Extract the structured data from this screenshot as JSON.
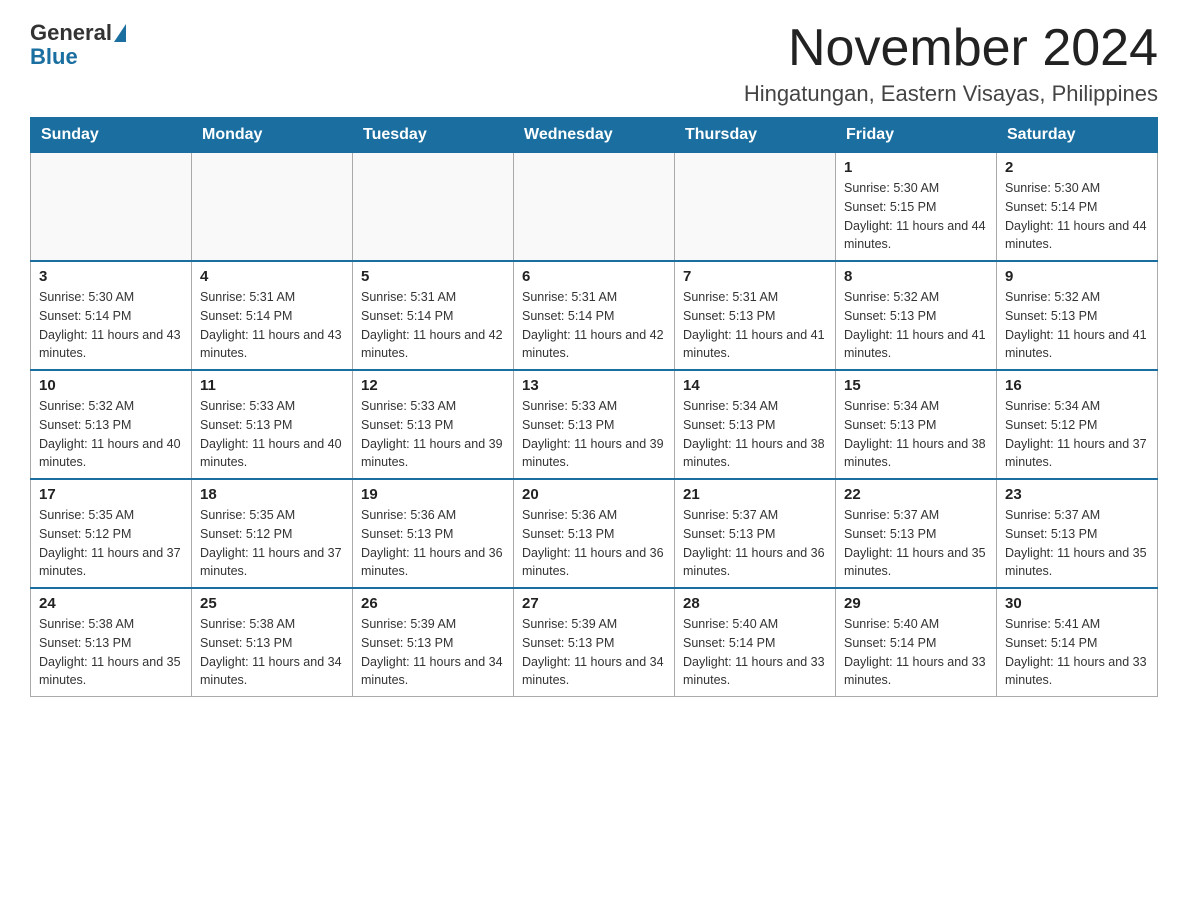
{
  "logo": {
    "text_general": "General",
    "text_blue": "Blue"
  },
  "header": {
    "month_title": "November 2024",
    "location": "Hingatungan, Eastern Visayas, Philippines"
  },
  "days_of_week": [
    "Sunday",
    "Monday",
    "Tuesday",
    "Wednesday",
    "Thursday",
    "Friday",
    "Saturday"
  ],
  "weeks": [
    [
      {
        "day": "",
        "sunrise": "",
        "sunset": "",
        "daylight": ""
      },
      {
        "day": "",
        "sunrise": "",
        "sunset": "",
        "daylight": ""
      },
      {
        "day": "",
        "sunrise": "",
        "sunset": "",
        "daylight": ""
      },
      {
        "day": "",
        "sunrise": "",
        "sunset": "",
        "daylight": ""
      },
      {
        "day": "",
        "sunrise": "",
        "sunset": "",
        "daylight": ""
      },
      {
        "day": "1",
        "sunrise": "Sunrise: 5:30 AM",
        "sunset": "Sunset: 5:15 PM",
        "daylight": "Daylight: 11 hours and 44 minutes."
      },
      {
        "day": "2",
        "sunrise": "Sunrise: 5:30 AM",
        "sunset": "Sunset: 5:14 PM",
        "daylight": "Daylight: 11 hours and 44 minutes."
      }
    ],
    [
      {
        "day": "3",
        "sunrise": "Sunrise: 5:30 AM",
        "sunset": "Sunset: 5:14 PM",
        "daylight": "Daylight: 11 hours and 43 minutes."
      },
      {
        "day": "4",
        "sunrise": "Sunrise: 5:31 AM",
        "sunset": "Sunset: 5:14 PM",
        "daylight": "Daylight: 11 hours and 43 minutes."
      },
      {
        "day": "5",
        "sunrise": "Sunrise: 5:31 AM",
        "sunset": "Sunset: 5:14 PM",
        "daylight": "Daylight: 11 hours and 42 minutes."
      },
      {
        "day": "6",
        "sunrise": "Sunrise: 5:31 AM",
        "sunset": "Sunset: 5:14 PM",
        "daylight": "Daylight: 11 hours and 42 minutes."
      },
      {
        "day": "7",
        "sunrise": "Sunrise: 5:31 AM",
        "sunset": "Sunset: 5:13 PM",
        "daylight": "Daylight: 11 hours and 41 minutes."
      },
      {
        "day": "8",
        "sunrise": "Sunrise: 5:32 AM",
        "sunset": "Sunset: 5:13 PM",
        "daylight": "Daylight: 11 hours and 41 minutes."
      },
      {
        "day": "9",
        "sunrise": "Sunrise: 5:32 AM",
        "sunset": "Sunset: 5:13 PM",
        "daylight": "Daylight: 11 hours and 41 minutes."
      }
    ],
    [
      {
        "day": "10",
        "sunrise": "Sunrise: 5:32 AM",
        "sunset": "Sunset: 5:13 PM",
        "daylight": "Daylight: 11 hours and 40 minutes."
      },
      {
        "day": "11",
        "sunrise": "Sunrise: 5:33 AM",
        "sunset": "Sunset: 5:13 PM",
        "daylight": "Daylight: 11 hours and 40 minutes."
      },
      {
        "day": "12",
        "sunrise": "Sunrise: 5:33 AM",
        "sunset": "Sunset: 5:13 PM",
        "daylight": "Daylight: 11 hours and 39 minutes."
      },
      {
        "day": "13",
        "sunrise": "Sunrise: 5:33 AM",
        "sunset": "Sunset: 5:13 PM",
        "daylight": "Daylight: 11 hours and 39 minutes."
      },
      {
        "day": "14",
        "sunrise": "Sunrise: 5:34 AM",
        "sunset": "Sunset: 5:13 PM",
        "daylight": "Daylight: 11 hours and 38 minutes."
      },
      {
        "day": "15",
        "sunrise": "Sunrise: 5:34 AM",
        "sunset": "Sunset: 5:13 PM",
        "daylight": "Daylight: 11 hours and 38 minutes."
      },
      {
        "day": "16",
        "sunrise": "Sunrise: 5:34 AM",
        "sunset": "Sunset: 5:12 PM",
        "daylight": "Daylight: 11 hours and 37 minutes."
      }
    ],
    [
      {
        "day": "17",
        "sunrise": "Sunrise: 5:35 AM",
        "sunset": "Sunset: 5:12 PM",
        "daylight": "Daylight: 11 hours and 37 minutes."
      },
      {
        "day": "18",
        "sunrise": "Sunrise: 5:35 AM",
        "sunset": "Sunset: 5:12 PM",
        "daylight": "Daylight: 11 hours and 37 minutes."
      },
      {
        "day": "19",
        "sunrise": "Sunrise: 5:36 AM",
        "sunset": "Sunset: 5:13 PM",
        "daylight": "Daylight: 11 hours and 36 minutes."
      },
      {
        "day": "20",
        "sunrise": "Sunrise: 5:36 AM",
        "sunset": "Sunset: 5:13 PM",
        "daylight": "Daylight: 11 hours and 36 minutes."
      },
      {
        "day": "21",
        "sunrise": "Sunrise: 5:37 AM",
        "sunset": "Sunset: 5:13 PM",
        "daylight": "Daylight: 11 hours and 36 minutes."
      },
      {
        "day": "22",
        "sunrise": "Sunrise: 5:37 AM",
        "sunset": "Sunset: 5:13 PM",
        "daylight": "Daylight: 11 hours and 35 minutes."
      },
      {
        "day": "23",
        "sunrise": "Sunrise: 5:37 AM",
        "sunset": "Sunset: 5:13 PM",
        "daylight": "Daylight: 11 hours and 35 minutes."
      }
    ],
    [
      {
        "day": "24",
        "sunrise": "Sunrise: 5:38 AM",
        "sunset": "Sunset: 5:13 PM",
        "daylight": "Daylight: 11 hours and 35 minutes."
      },
      {
        "day": "25",
        "sunrise": "Sunrise: 5:38 AM",
        "sunset": "Sunset: 5:13 PM",
        "daylight": "Daylight: 11 hours and 34 minutes."
      },
      {
        "day": "26",
        "sunrise": "Sunrise: 5:39 AM",
        "sunset": "Sunset: 5:13 PM",
        "daylight": "Daylight: 11 hours and 34 minutes."
      },
      {
        "day": "27",
        "sunrise": "Sunrise: 5:39 AM",
        "sunset": "Sunset: 5:13 PM",
        "daylight": "Daylight: 11 hours and 34 minutes."
      },
      {
        "day": "28",
        "sunrise": "Sunrise: 5:40 AM",
        "sunset": "Sunset: 5:14 PM",
        "daylight": "Daylight: 11 hours and 33 minutes."
      },
      {
        "day": "29",
        "sunrise": "Sunrise: 5:40 AM",
        "sunset": "Sunset: 5:14 PM",
        "daylight": "Daylight: 11 hours and 33 minutes."
      },
      {
        "day": "30",
        "sunrise": "Sunrise: 5:41 AM",
        "sunset": "Sunset: 5:14 PM",
        "daylight": "Daylight: 11 hours and 33 minutes."
      }
    ]
  ]
}
